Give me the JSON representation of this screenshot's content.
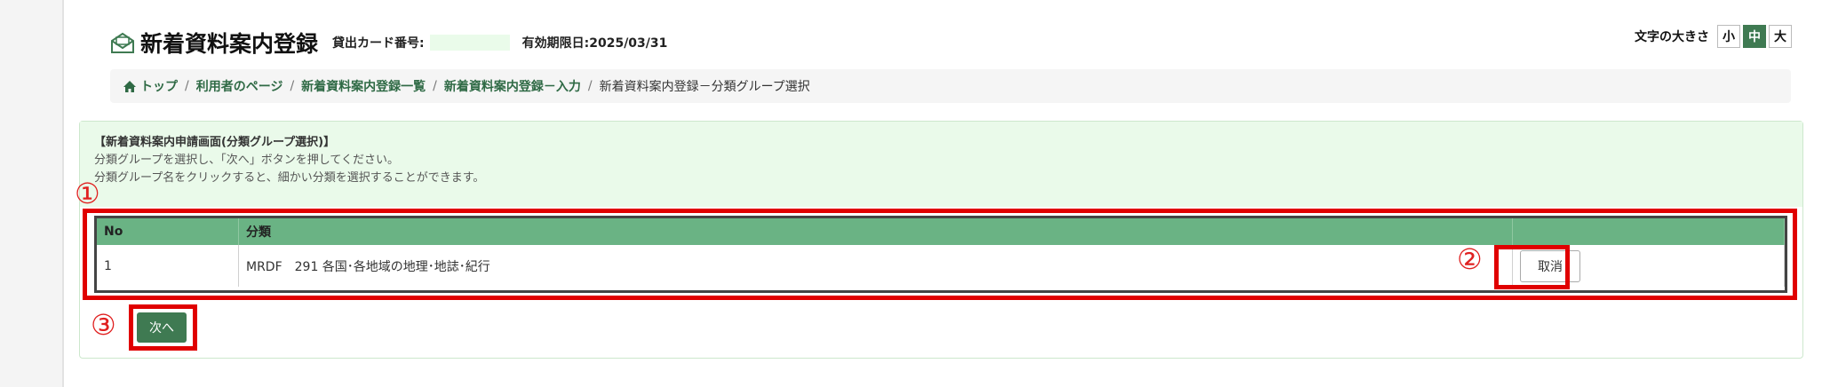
{
  "header": {
    "title": "新着資料案内登録",
    "card_label": "貸出カード番号:",
    "card_value": "",
    "expiry": "有効期限日:2025/03/31"
  },
  "font_size": {
    "label": "文字の大きさ",
    "options": [
      "小",
      "中",
      "大"
    ],
    "selected": "中",
    "accent_color": "#3f7a52"
  },
  "breadcrumb": {
    "items": [
      "トップ",
      "利用者のページ",
      "新着資料案内登録一覧",
      "新着資料案内登録－入力"
    ],
    "separator": "/",
    "current": "新着資料案内登録－分類グループ選択",
    "home_icon": "home-icon"
  },
  "info": {
    "title": "【新着資料案内申請画面(分類グループ選択)】",
    "line1": "分類グループを選択し、「次へ」ボタンを押してください。",
    "line2": "分類グループ名をクリックすると、細かい分類を選択することができます。"
  },
  "markers": [
    "①",
    "②",
    "③"
  ],
  "table": {
    "headers": [
      "No",
      "分類",
      ""
    ],
    "rows": [
      {
        "no": "1",
        "category": "MRDF　291 各国･各地域の地理･地誌･紀行",
        "action": "取消"
      }
    ],
    "header_color": "#6ab384"
  },
  "next_label": "次へ",
  "highlight_color": "#e00000"
}
